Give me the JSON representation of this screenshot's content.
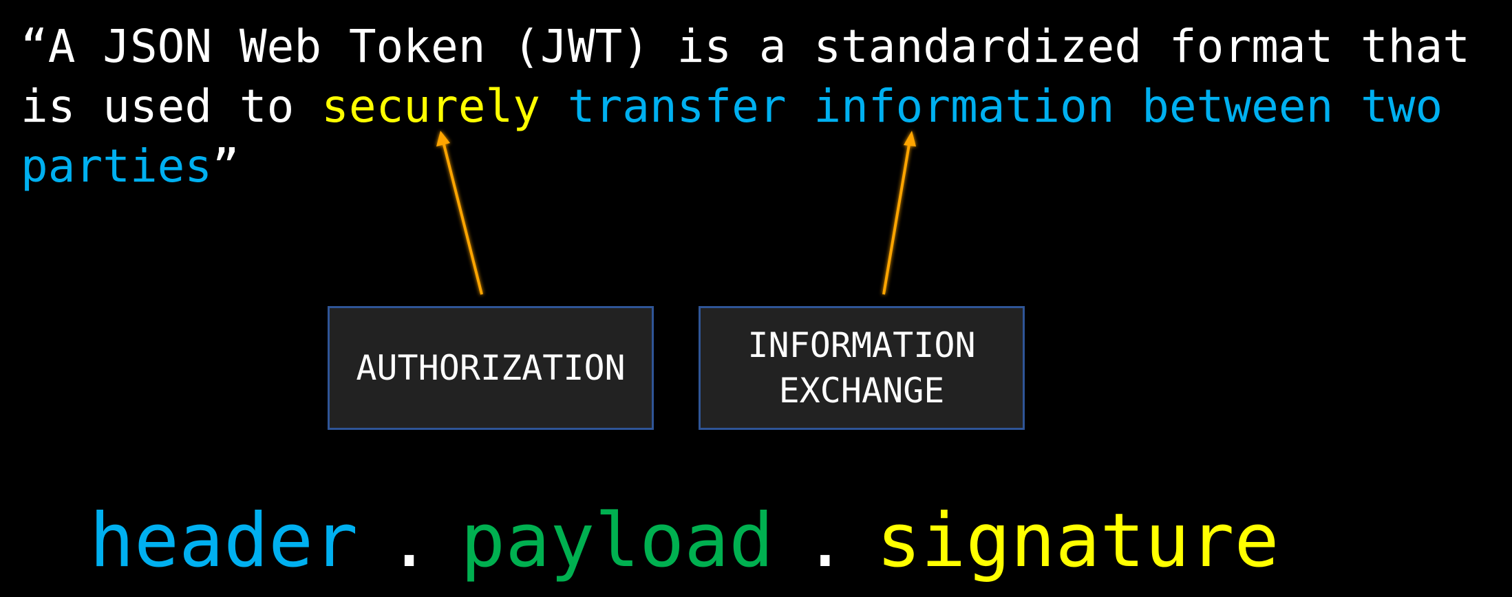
{
  "quote": {
    "line1": "“A JSON Web Token (JWT) is a standardized format that",
    "line2_prefix": "is used to ",
    "line2_securely": "securely",
    "line2_space": " ",
    "line2_blue": "transfer information between two",
    "line3_blue": "parties",
    "line3_suffix": "”"
  },
  "boxes": {
    "authorization": "AUTHORIZATION",
    "information_line1": "INFORMATION",
    "information_line2": "EXCHANGE"
  },
  "formula": {
    "header": "header",
    "dot1": ".",
    "payload": "payload",
    "dot2": ".",
    "signature": "signature"
  },
  "colors": {
    "background": "#000000",
    "text": "#ffffff",
    "highlight_yellow": "#ffff00",
    "highlight_blue": "#00b0f0",
    "payload_green": "#00b050",
    "box_fill": "#222222",
    "box_border": "#2f5597",
    "arrow": "#ffa500"
  }
}
